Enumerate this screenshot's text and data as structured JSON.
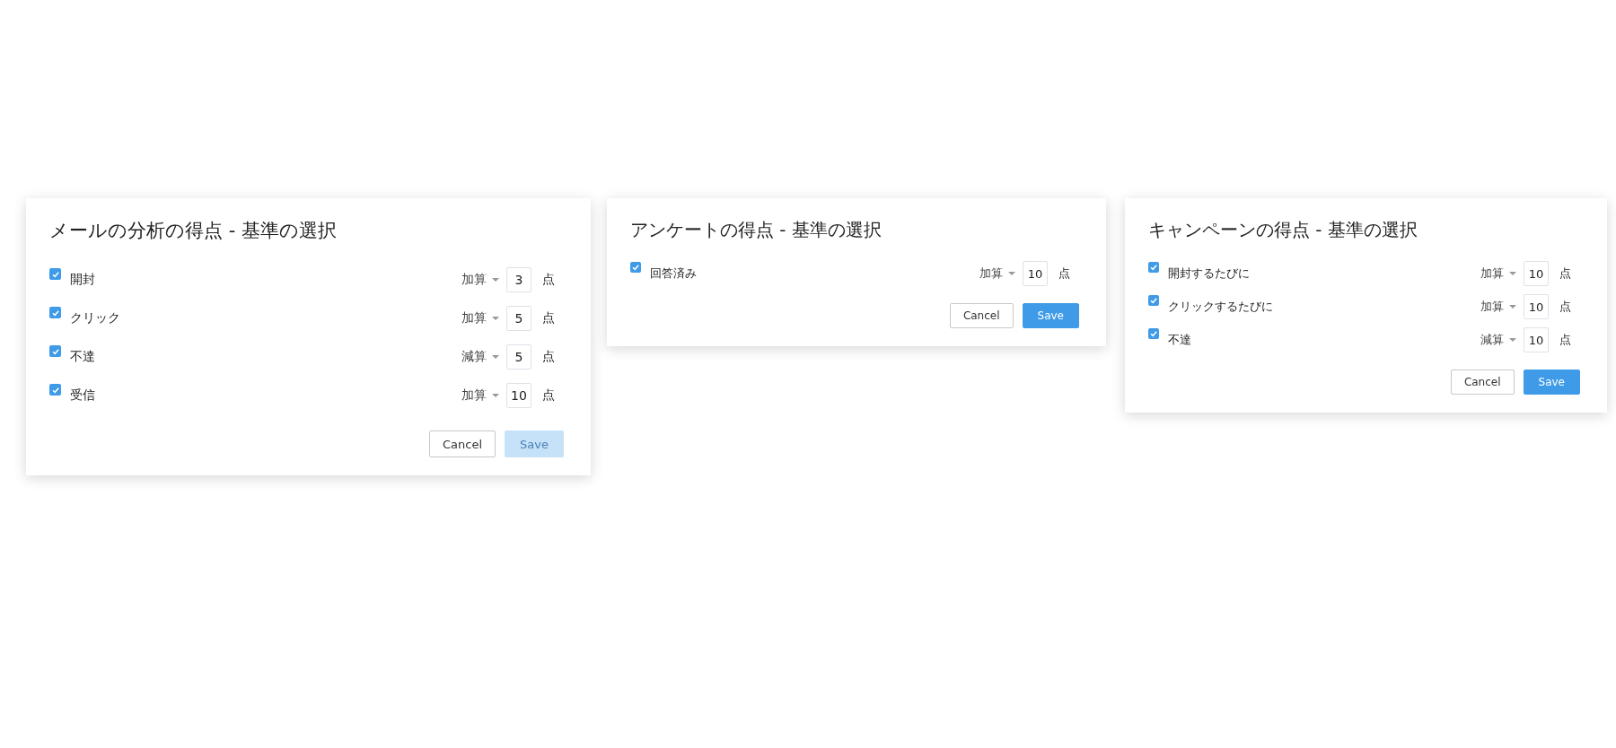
{
  "dialogs": [
    {
      "title": "メールの分析の得点 - 基準の選択",
      "criteria": [
        {
          "label": "開封",
          "checked": true,
          "operation": "加算",
          "points": "3",
          "unit": "点"
        },
        {
          "label": "クリック",
          "checked": true,
          "operation": "加算",
          "points": "5",
          "unit": "点"
        },
        {
          "label": "不達",
          "checked": true,
          "operation": "減算",
          "points": "5",
          "unit": "点"
        },
        {
          "label": "受信",
          "checked": true,
          "operation": "加算",
          "points": "10",
          "unit": "点"
        }
      ],
      "buttons": [
        {
          "label": "Cancel",
          "kind": "secondary",
          "disabled": false
        },
        {
          "label": "Save",
          "kind": "primary",
          "disabled": true
        }
      ]
    },
    {
      "title": "アンケートの得点 - 基準の選択",
      "criteria": [
        {
          "label": "回答済み",
          "checked": true,
          "operation": "加算",
          "points": "10",
          "unit": "点"
        }
      ],
      "buttons": [
        {
          "label": "Cancel",
          "kind": "secondary",
          "disabled": false
        },
        {
          "label": "Save",
          "kind": "primary",
          "disabled": false
        }
      ]
    },
    {
      "title": "キャンペーンの得点 - 基準の選択",
      "criteria": [
        {
          "label": "開封するたびに",
          "checked": true,
          "operation": "加算",
          "points": "10",
          "unit": "点"
        },
        {
          "label": "クリックするたびに",
          "checked": true,
          "operation": "加算",
          "points": "10",
          "unit": "点"
        },
        {
          "label": "不達",
          "checked": true,
          "operation": "減算",
          "points": "10",
          "unit": "点"
        }
      ],
      "buttons": [
        {
          "label": "Cancel",
          "kind": "secondary",
          "disabled": false
        },
        {
          "label": "Save",
          "kind": "primary",
          "disabled": false
        }
      ]
    }
  ]
}
